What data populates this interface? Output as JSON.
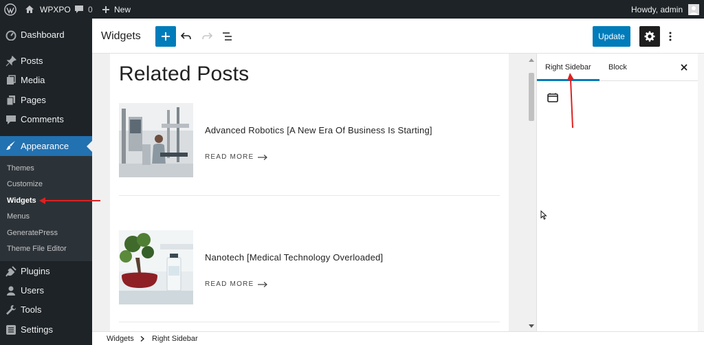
{
  "admin_bar": {
    "site_name": "WPXPO",
    "comments_count": "0",
    "new_label": "New",
    "greeting": "Howdy, admin"
  },
  "sidebar": {
    "menu": [
      {
        "label": "Dashboard",
        "icon": "dashboard-icon"
      },
      {
        "label": "Posts",
        "icon": "pin-icon"
      },
      {
        "label": "Media",
        "icon": "media-icon"
      },
      {
        "label": "Pages",
        "icon": "pages-icon"
      },
      {
        "label": "Comments",
        "icon": "comment-icon"
      },
      {
        "label": "Appearance",
        "icon": "brush-icon"
      }
    ],
    "submenu": [
      "Themes",
      "Customize",
      "Widgets",
      "Menus",
      "GeneratePress",
      "Theme File Editor"
    ],
    "menu_bottom": [
      {
        "label": "Plugins",
        "icon": "plugin-icon"
      },
      {
        "label": "Users",
        "icon": "user-icon"
      },
      {
        "label": "Tools",
        "icon": "wrench-icon"
      },
      {
        "label": "Settings",
        "icon": "settings-icon"
      }
    ],
    "accent": "#2271b1"
  },
  "header": {
    "title": "Widgets",
    "update_label": "Update"
  },
  "content": {
    "heading": "Related Posts",
    "posts": [
      {
        "title": "Advanced Robotics [A New Era Of Business Is Starting]",
        "read_more": "READ MORE"
      },
      {
        "title": "Nanotech [Medical Technology Overloaded]",
        "read_more": "READ MORE"
      }
    ]
  },
  "panel": {
    "tab_active": "Right Sidebar",
    "tab_other": "Block"
  },
  "footer": {
    "crumb_root": "Widgets",
    "crumb_current": "Right Sidebar"
  }
}
